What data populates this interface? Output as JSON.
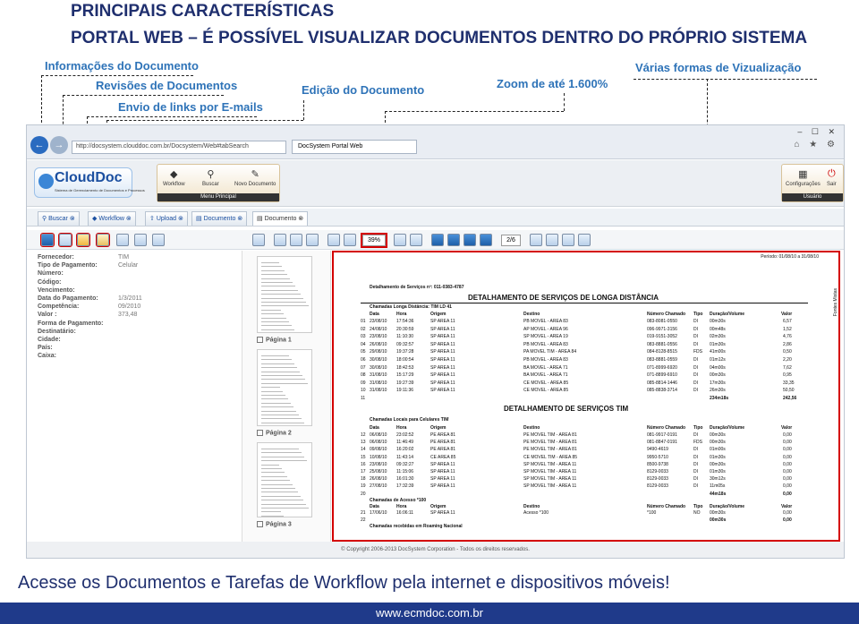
{
  "slide": {
    "title": "PRINCIPAIS CARACTERÍSTICAS",
    "subtitle": "PORTAL WEB – É POSSÍVEL VISUALIZAR DOCUMENTOS DENTRO DO PRÓPRIO SISTEMA",
    "bottom_text": "Acesse os Documentos e Tarefas de Workflow pela internet e dispositivos móveis!",
    "website": "www.ecmdoc.com.br",
    "callouts": {
      "info": "Informações do Documento",
      "revisions": "Revisões de Documentos",
      "email": "Envio de links por E-mails",
      "edit": "Edição do Documento",
      "zoom": "Zoom de até 1.600%",
      "views": "Várias formas de Vizualização"
    },
    "colors": {
      "title": "#1f2f6e",
      "callout": "#2e73b8",
      "highlight": "#d40000",
      "bar": "#1f3a8a"
    }
  },
  "browser": {
    "url": "http://docsystem.clouddoc.com.br/Docsystem/Web#tabSearch",
    "tab": "DocSystem Portal Web",
    "window_controls": "– ☐ ✕",
    "fav_icons": "⌂ ★ ⚙"
  },
  "app": {
    "logo": "CloudDoc",
    "logo_sub": "Sistema de Gerenciamento de Documentos e Processos",
    "menu": {
      "workflow": "Workflow",
      "buscar": "Buscar",
      "novo": "Novo Documento",
      "label": "Menu Principal"
    },
    "user": {
      "config": "Configurações",
      "sair": "Sair",
      "label": "Usuário"
    },
    "tabs": [
      "Buscar",
      "Workflow",
      "Upload",
      "Documento",
      "Documento"
    ],
    "zoom": "39%",
    "page": "2/6"
  },
  "fields": [
    {
      "label": "Fornecedor:",
      "value": "TIM"
    },
    {
      "label": "Tipo de Pagamento:",
      "value": "Celular"
    },
    {
      "label": "Número:",
      "value": ""
    },
    {
      "label": "Código:",
      "value": ""
    },
    {
      "label": "Vencimento:",
      "value": ""
    },
    {
      "label": "Data do Pagamento:",
      "value": "1/3/2011"
    },
    {
      "label": "Competência:",
      "value": "09/2010"
    },
    {
      "label": "Valor :",
      "value": "373,48"
    },
    {
      "label": "Forma de Pagamento:",
      "value": ""
    },
    {
      "label": "Destinatário:",
      "value": ""
    },
    {
      "label": "Cidade:",
      "value": ""
    },
    {
      "label": "País:",
      "value": ""
    },
    {
      "label": "Caixa:",
      "value": ""
    }
  ],
  "thumbs": [
    "Página 1",
    "Página 2",
    "Página 3"
  ],
  "document": {
    "header_ref": "Detalhamento de Serviços nº: 011-0383-4787",
    "title": "DETALHAMENTO DE SERVIÇOS DE LONGA DISTÂNCIA",
    "period": "Período: 01/08/10 a 31/08/10",
    "side_text": "Fontes Mistas",
    "section1": "Chamadas Longa Distância: TIM LD 41",
    "cols": [
      "Data",
      "Hora",
      "Origem",
      "Destino",
      "Número Chamado",
      "Tipo",
      "Duração/Volume",
      "Valor"
    ],
    "rows1": [
      [
        "01",
        "23/08/10",
        "17:54:36",
        "SP AREA 11",
        "PB MOVEL - AREA 83",
        "083-8081-0550",
        "DI",
        "00m30s",
        "6,57"
      ],
      [
        "02",
        "24/08/10",
        "20:30:59",
        "SP AREA 11",
        "AP MOVEL - AREA 96",
        "096-9971-3156",
        "DI",
        "00m48s",
        "1,52"
      ],
      [
        "03",
        "23/08/10",
        "11:10:30",
        "SP AREA 11",
        "SP MOVEL - AREA 19",
        "019-9151-3052",
        "DI",
        "02m30s",
        "4,76"
      ],
      [
        "04",
        "26/08/10",
        "09:32:57",
        "SP AREA 11",
        "PB MOVEL - AREA 83",
        "083-8881-0556",
        "DI",
        "01m30s",
        "2,86"
      ],
      [
        "05",
        "29/08/10",
        "19:37:28",
        "SP AREA 11",
        "PA MOVEL TIM - AREA 84",
        "084-8128-8515",
        "FDS",
        "41m00s",
        "0,50"
      ],
      [
        "06",
        "30/08/10",
        "18:00:54",
        "SP AREA 11",
        "PB MOVEL - AREA 83",
        "083-8881-0559",
        "DI",
        "01m12s",
        "2,20"
      ],
      [
        "07",
        "30/08/10",
        "18:42:53",
        "SP AREA 11",
        "BA MOVEL - AREA 71",
        "071-8999-6920",
        "DI",
        "04m00s",
        "7,62"
      ],
      [
        "08",
        "31/08/10",
        "15:17:29",
        "SP AREA 11",
        "BA MOVEL - AREA 71",
        "071-8899-6910",
        "DI",
        "00m30s",
        "0,95"
      ],
      [
        "09",
        "31/08/10",
        "19:27:39",
        "SP AREA 11",
        "CE MOVEL - AREA 85",
        "085-8814-1446",
        "DI",
        "17m30s",
        "33,35"
      ],
      [
        "10",
        "31/08/10",
        "19:11:36",
        "SP AREA 11",
        "CE MOVEL - AREA 85",
        "085-8838-3714",
        "DI",
        "26m30s",
        "50,50"
      ]
    ],
    "total1": [
      "234m18s",
      "242,56"
    ],
    "title2": "DETALHAMENTO DE SERVIÇOS TIM",
    "section2": "Chamadas Locais para Celulares TIM",
    "rows2": [
      [
        "12",
        "06/08/10",
        "23:02:52",
        "PE AREA 81",
        "PE MOVEL TIM - AREA 81",
        "081-9917-0191",
        "DI",
        "00m30s",
        "0,00"
      ],
      [
        "13",
        "06/08/10",
        "11:46:49",
        "PE AREA 81",
        "PE MOVEL TIM - AREA 81",
        "081-8847-0191",
        "FDS",
        "00m30s",
        "0,00"
      ],
      [
        "14",
        "09/08/10",
        "16:20:02",
        "PE AREA 81",
        "PE MOVEL TIM - AREA 81",
        "9490-4619",
        "DI",
        "01m00s",
        "0,00"
      ],
      [
        "15",
        "10/08/10",
        "11:43:14",
        "CE AREA 85",
        "CE MOVEL TIM - AREA 85",
        "9950-5710",
        "DI",
        "01m30s",
        "0,00"
      ],
      [
        "16",
        "23/08/10",
        "09:32:27",
        "SP AREA 11",
        "SP MOVEL TIM - AREA 11",
        "8500-9738",
        "DI",
        "00m30s",
        "0,00"
      ],
      [
        "17",
        "25/08/10",
        "11:15:06",
        "SP AREA 11",
        "SP MOVEL TIM - AREA 11",
        "8129-0033",
        "DI",
        "01m30s",
        "0,00"
      ],
      [
        "18",
        "26/08/10",
        "16:01:30",
        "SP AREA 11",
        "SP MOVEL TIM - AREA 11",
        "8129-0033",
        "DI",
        "30m12s",
        "0,00"
      ],
      [
        "19",
        "27/08/10",
        "17:32:39",
        "SP AREA 11",
        "SP MOVEL TIM - AREA 11",
        "8129-0033",
        "DI",
        "11m05s",
        "0,00"
      ]
    ],
    "total2": [
      "44m18s",
      "0,00"
    ],
    "section3": "Chamadas de Acesso *100",
    "rows3": [
      [
        "21",
        "17/06/10",
        "16:06:11",
        "SP AREA 11",
        "Acesso *100",
        "*100",
        "NO",
        "00m30s",
        "0,00"
      ]
    ],
    "total3": [
      "00m30s",
      "0,00"
    ],
    "section4": "Chamadas recebidas em Roaming Nacional"
  },
  "footer": "© Copyright 2006-2013 DocSystem Corporation - Todos os direitos reservados."
}
